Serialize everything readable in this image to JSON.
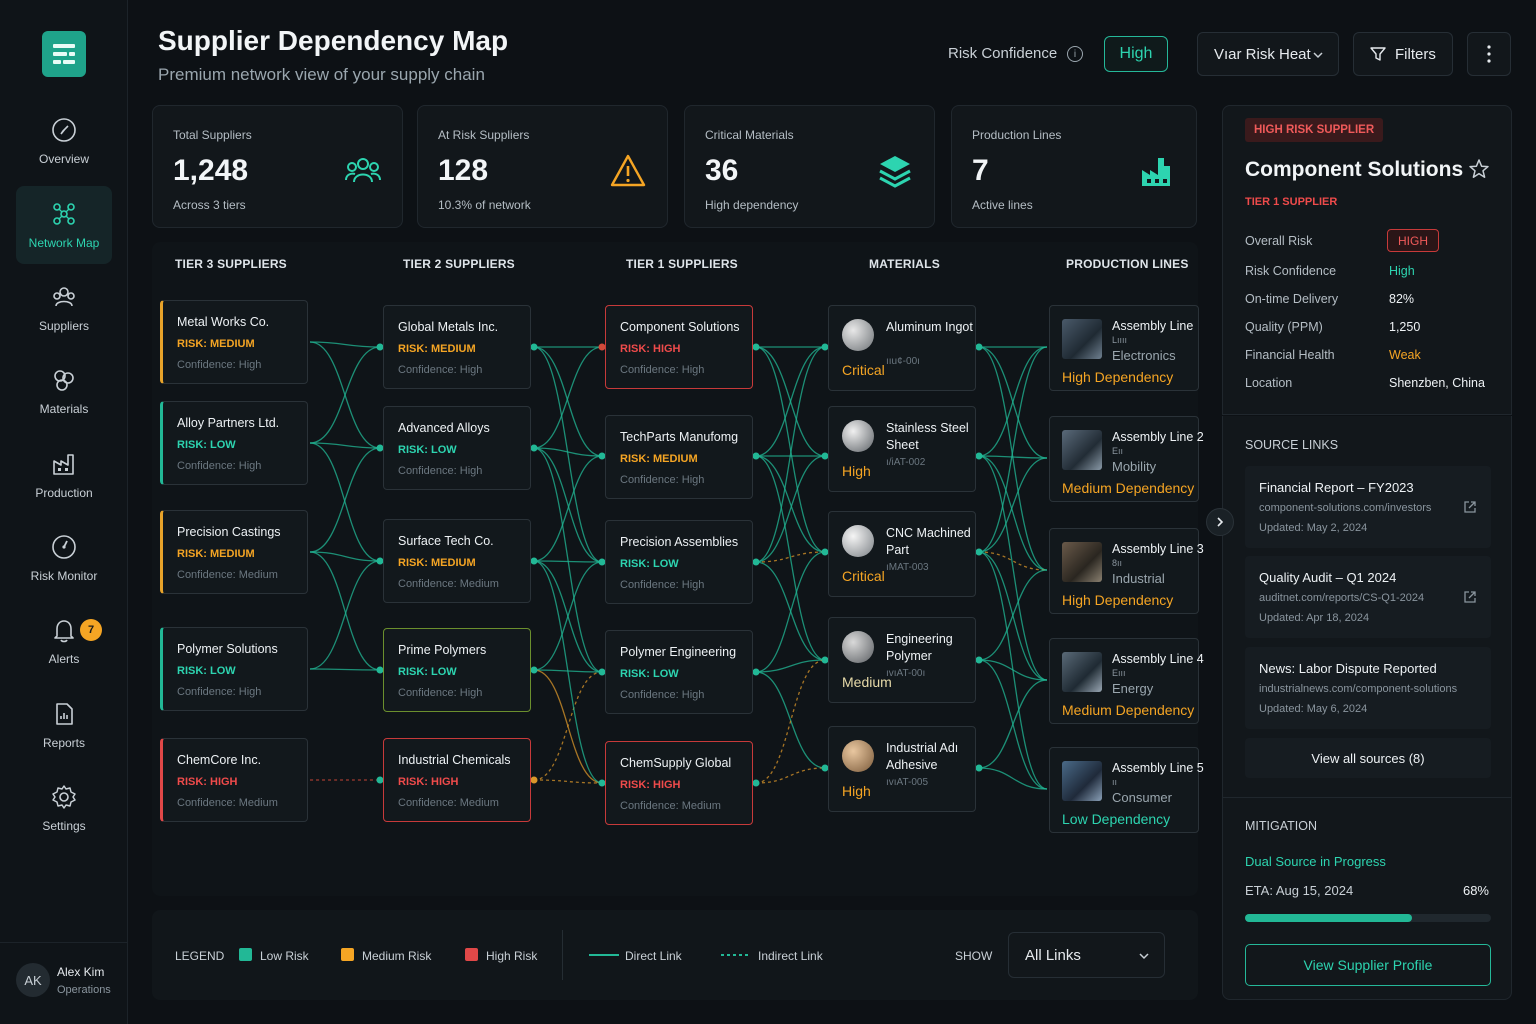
{
  "header": {
    "title": "Supplier Dependency Map",
    "subtitle": "Premium network view of your supply chain",
    "risk_confidence_label": "Risk Confidence",
    "risk_confidence_value": "High",
    "view_select": "Vıar Risk Heat",
    "filters_label": "Filters"
  },
  "sidebar": {
    "items": [
      {
        "label": "Overview",
        "icon": "compass-icon"
      },
      {
        "label": "Network Map",
        "icon": "network-icon"
      },
      {
        "label": "Suppliers",
        "icon": "suppliers-icon"
      },
      {
        "label": "Materials",
        "icon": "materials-icon"
      },
      {
        "label": "Production",
        "icon": "factory-icon"
      },
      {
        "label": "Risk Monitor",
        "icon": "gauge-icon"
      },
      {
        "label": "Alerts",
        "icon": "bell-icon"
      },
      {
        "label": "Reports",
        "icon": "report-icon"
      },
      {
        "label": "Settings",
        "icon": "gear-icon"
      }
    ],
    "alerts_badge": "7",
    "user": {
      "initials": "AK",
      "name": "Alex Kim",
      "role": "Operations"
    }
  },
  "stats": [
    {
      "label": "Total Suppliers",
      "value": "1,248",
      "sub": "Across 3 tiers",
      "icon": "users-icon"
    },
    {
      "label": "At Risk Suppliers",
      "value": "128",
      "sub": "10.3% of network",
      "icon": "warning-icon"
    },
    {
      "label": "Critical Materials",
      "value": "36",
      "sub": "High dependency",
      "icon": "layers-icon"
    },
    {
      "label": "Production Lines",
      "value": "7",
      "sub": "Active lines",
      "icon": "factory-icon"
    }
  ],
  "columns": [
    "TIER 3 SUPPLIERS",
    "TIER 2 SUPPLIERS",
    "TIER 1 SUPPLIERS",
    "MATERIALS",
    "PRODUCTION LINES"
  ],
  "tier3": [
    {
      "name": "Metal Works Co.",
      "risk": "RISK: MEDIUM",
      "conf": "Confidence: High"
    },
    {
      "name": "Alloy Partners Ltd.",
      "risk": "RISK: LOW",
      "conf": "Confidence: High"
    },
    {
      "name": "Precision Castings",
      "risk": "RISK: MEDIUM",
      "conf": "Confidence: Medium"
    },
    {
      "name": "Polymer Solutions",
      "risk": "RISK: LOW",
      "conf": "Confidence: High"
    },
    {
      "name": "ChemCore Inc.",
      "risk": "RISK: HIGH",
      "conf": "Confidence: Medium"
    }
  ],
  "tier2": [
    {
      "name": "Global Metals Inc.",
      "risk": "RISK: MEDIUM",
      "conf": "Confidence: High"
    },
    {
      "name": "Advanced Alloys",
      "risk": "RISK: LOW",
      "conf": "Confidence: High"
    },
    {
      "name": "Surface Tech Co.",
      "risk": "RISK: MEDIUM",
      "conf": "Confidence: Medium"
    },
    {
      "name": "Prime Polymers",
      "risk": "RISK: LOW",
      "conf": "Confidence: High"
    },
    {
      "name": "Industrial Chemicals",
      "risk": "RISK: HIGH",
      "conf": "Confidence: Medium"
    }
  ],
  "tier1": [
    {
      "name": "Component Solutions",
      "risk": "RISK: HIGH",
      "conf": "Confidence: High"
    },
    {
      "name": "TechParts Manufomg",
      "risk": "RISK: MEDIUM",
      "conf": "Confidence: High"
    },
    {
      "name": "Precision Assemblies",
      "risk": "RISK: LOW",
      "conf": "Confidence: High"
    },
    {
      "name": "Polymer Engineering",
      "risk": "RISK: LOW",
      "conf": "Confidence: High"
    },
    {
      "name": "ChemSupply Global",
      "risk": "RISK: HIGH",
      "conf": "Confidence: Medium"
    }
  ],
  "materials": [
    {
      "name": "Aluminum Ingot",
      "code": "ııu¢-00ı",
      "level": "Critical"
    },
    {
      "name": "Stainless Steel Sheet",
      "code": "ı/iAT-002",
      "level": "High"
    },
    {
      "name": "CNC Machined Part",
      "code": "ıMAT-003",
      "level": "Critical"
    },
    {
      "name": "Engineering Polymer",
      "code": "ıvıAT-00ı",
      "level": "Medium"
    },
    {
      "name": "Industrial Adı Adhesive",
      "code": "ıvıAT-005",
      "level": "High"
    }
  ],
  "production": [
    {
      "name": "Assembly Line",
      "code": "Lıııı",
      "cat": "Electronics",
      "dep": "High Dependency"
    },
    {
      "name": "Assembly Line 2",
      "code": "Eıı",
      "cat": "Mobility",
      "dep": "Medium Dependency"
    },
    {
      "name": "Assembly Line 3",
      "code": "8ıı",
      "cat": "Industrial",
      "dep": "High Dependency"
    },
    {
      "name": "Assembly Line 4",
      "code": "Eııı",
      "cat": "Energy",
      "dep": "Medium Dependency"
    },
    {
      "name": "Assembly Line 5",
      "code": "ıı",
      "cat": "Consumer",
      "dep": "Low Dependency"
    }
  ],
  "legend": {
    "title": "LEGEND",
    "low": "Low Risk",
    "medium": "Medium Risk",
    "high": "High Risk",
    "direct": "Direct Link",
    "indirect": "Indirect Link",
    "show_label": "SHOW",
    "show_value": "All Links"
  },
  "detail": {
    "badge": "HIGH RISK SUPPLIER",
    "name": "Component Solutions",
    "tier": "TIER 1 SUPPLIER",
    "rows": [
      {
        "k": "Overall Risk",
        "v": "HIGH"
      },
      {
        "k": "Risk Confidence",
        "v": "High"
      },
      {
        "k": "On-time Delivery",
        "v": "82%"
      },
      {
        "k": "Quality (PPM)",
        "v": "1,250"
      },
      {
        "k": "Financial Health",
        "v": "Weak"
      },
      {
        "k": "Location",
        "v": "Shenzben, China"
      }
    ],
    "sources_title": "SOURCE LINKS",
    "sources": [
      {
        "title": "Financial Report – FY2023",
        "url": "component-solutions.com/investors",
        "updated": "Updated: May 2, 2024"
      },
      {
        "title": "Quality Audit – Q1 2024",
        "url": "auditnet.com/reports/CS-Q1-2024",
        "updated": "Updated: Apr 18, 2024"
      },
      {
        "title": "News: Labor Dispute Reported",
        "url": "industrialnews.com/component-solutions",
        "updated": "Updated: May 6, 2024"
      }
    ],
    "view_all": "View all sources (8)",
    "mitigation_title": "MITIGATION",
    "mitigation_status": "Dual Source in Progress",
    "mitigation_eta": "ETA: Aug 15, 2024",
    "mitigation_pct": "68%",
    "mitigation_progress": 0.68,
    "profile_button": "View Supplier Profile"
  },
  "colors": {
    "accent": "#2dd4b0",
    "medium": "#f5a524",
    "high": "#ef4b4b",
    "bg": "#0d1115"
  }
}
